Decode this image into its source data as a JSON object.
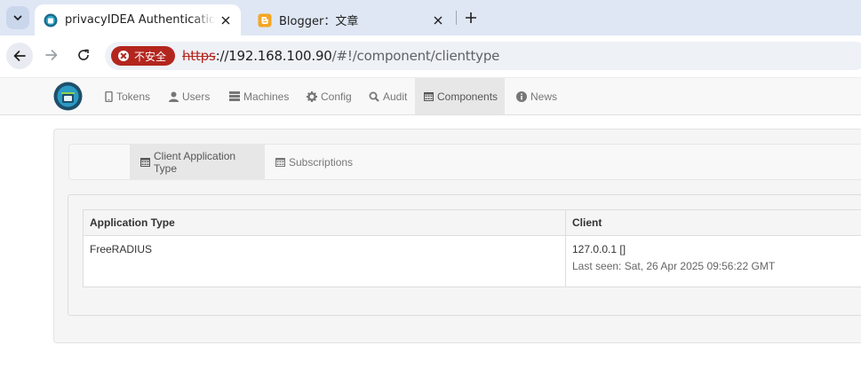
{
  "browser": {
    "tabs": [
      {
        "title": "privacyIDEA Authentication System",
        "active": true,
        "favicon": "privacyidea-favicon-icon"
      },
      {
        "title": "Blogger：文章",
        "active": false,
        "favicon": "blogger-favicon-icon"
      }
    ],
    "security_chip": "不安全",
    "url": {
      "scheme": "https",
      "host": "://192.168.100.90",
      "path": "/#!/component/clienttype"
    }
  },
  "navbar": {
    "items": [
      {
        "label": "Tokens",
        "icon": "phone-icon"
      },
      {
        "label": "Users",
        "icon": "user-icon"
      },
      {
        "label": "Machines",
        "icon": "machines-icon"
      },
      {
        "label": "Config",
        "icon": "gear-icon"
      },
      {
        "label": "Audit",
        "icon": "search-icon"
      },
      {
        "label": "Components",
        "icon": "calendar-icon",
        "active": true
      },
      {
        "label": "News",
        "icon": "info-icon"
      }
    ]
  },
  "subnav": {
    "items": [
      {
        "label": "Client Application Type",
        "icon": "calendar-icon",
        "active": true
      },
      {
        "label": "Subscriptions",
        "icon": "calendar-icon"
      }
    ]
  },
  "table": {
    "headers": [
      "Application Type",
      "Client"
    ],
    "rows": [
      {
        "application_type": "FreeRADIUS",
        "client": "127.0.0.1 []",
        "last_seen": "Last seen: Sat, 26 Apr 2025 09:56:22 GMT"
      }
    ]
  },
  "colors": {
    "insecure": "#b3261e",
    "tabbar": "#dfe7f4",
    "navbar_active": "#e7e7e7"
  }
}
